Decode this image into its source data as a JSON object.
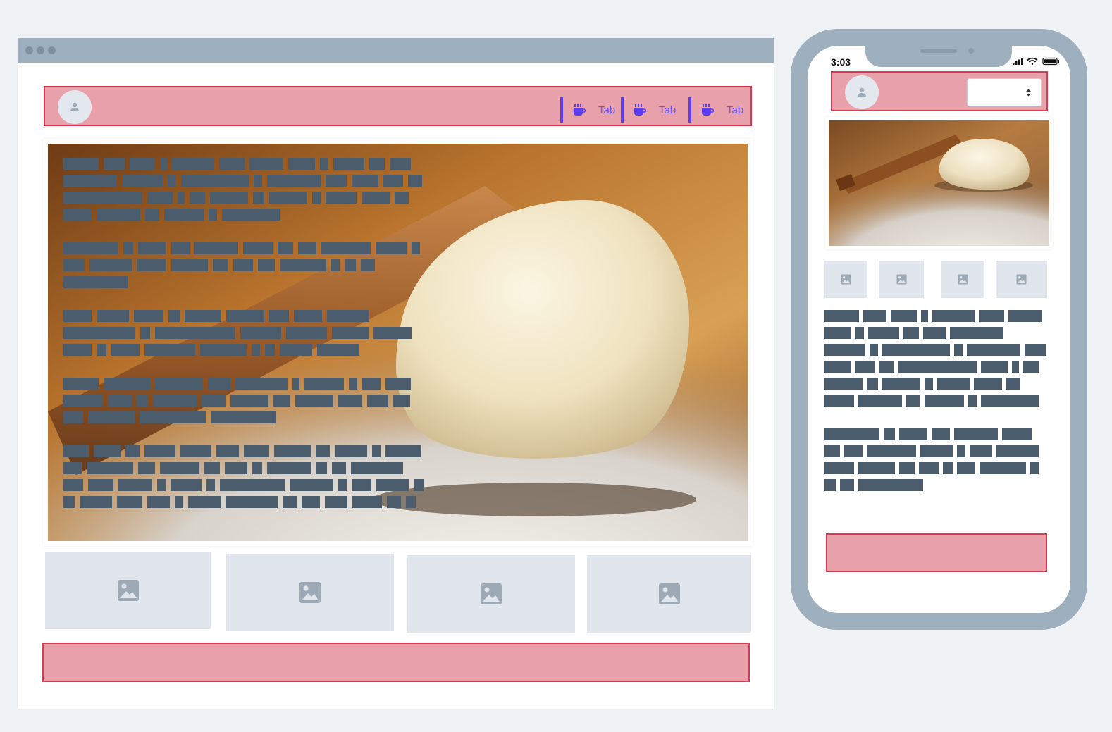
{
  "desktop": {
    "tabs": [
      {
        "label": "Tab",
        "icon": "coffee-icon"
      },
      {
        "label": "Tab",
        "icon": "coffee-icon"
      },
      {
        "label": "Tab",
        "icon": "coffee-icon"
      }
    ],
    "hero_image": "rolling-pin-and-dough-photo",
    "thumbnails": [
      "image-icon",
      "image-icon",
      "image-icon",
      "image-icon"
    ]
  },
  "phone": {
    "status_time": "3:03",
    "hero_image": "rolling-pin-and-dough-photo",
    "thumbnails": [
      "image-icon",
      "image-icon",
      "image-icon",
      "image-icon"
    ]
  },
  "colors": {
    "accent": "#5b3cf0",
    "header_fill": "#e8a1aa",
    "header_border": "#d63a52",
    "text_placeholder": "#4b5d6c",
    "frame": "#9eafbd"
  }
}
